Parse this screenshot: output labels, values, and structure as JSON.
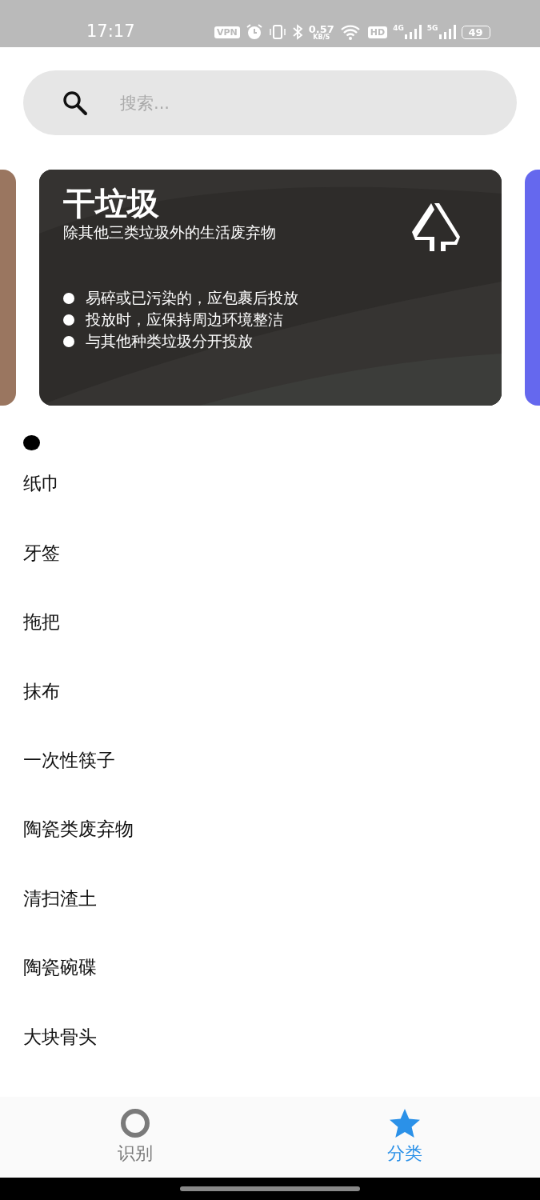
{
  "status_bar": {
    "time": "17:17",
    "vpn": "VPN",
    "speed_value": "0.57",
    "speed_unit": "KB/S",
    "hd": "HD",
    "net_4g": "4G",
    "net_5g": "5G",
    "battery": "49"
  },
  "search": {
    "placeholder": "搜索..."
  },
  "carousel": [
    {
      "kind": "side",
      "color": "#9a7660"
    },
    {
      "kind": "main",
      "title": "干垃圾",
      "subtitle": "除其他三类垃圾外的生活废弃物",
      "tips": [
        "易碎或已污染的，应包裹后投放",
        "投放时，应保持周边环境整洁",
        "与其他种类垃圾分开投放"
      ]
    },
    {
      "kind": "side",
      "color": "#6568ee"
    }
  ],
  "items": [
    "纸巾",
    "牙签",
    "拖把",
    "抹布",
    "一次性筷子",
    "陶瓷类废弃物",
    "清扫渣土",
    "陶瓷碗碟",
    "大块骨头"
  ],
  "nav": [
    {
      "label": "识别",
      "kind": "ring",
      "selected": false
    },
    {
      "label": "分类",
      "kind": "star",
      "selected": true
    }
  ]
}
